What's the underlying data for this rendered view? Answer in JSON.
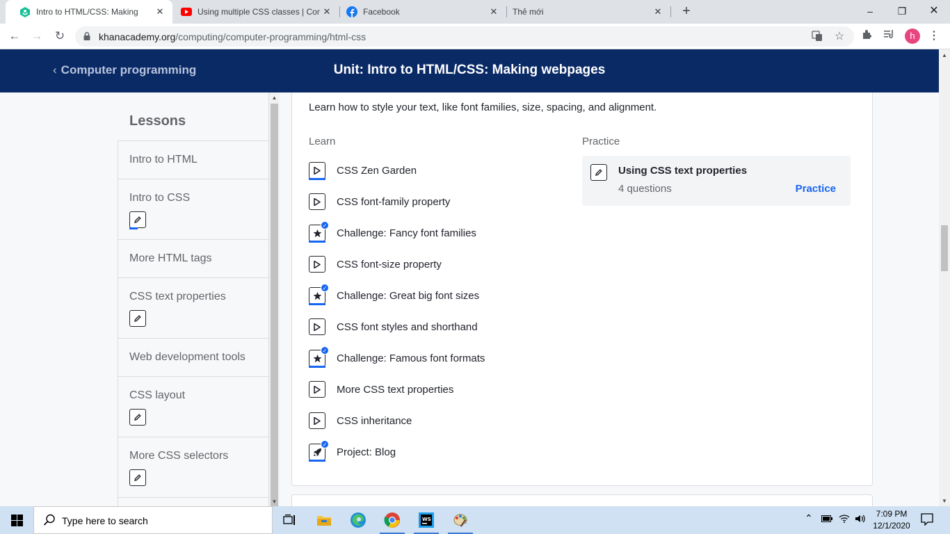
{
  "browser": {
    "tabs": [
      {
        "title": "Intro to HTML/CSS: Making webp",
        "active": true,
        "icon": "khan-academy-icon"
      },
      {
        "title": "Using multiple CSS classes | Com",
        "active": false,
        "icon": "youtube-icon"
      },
      {
        "title": "Facebook",
        "active": false,
        "icon": "facebook-icon"
      },
      {
        "title": "Thẻ mới",
        "active": false,
        "icon": ""
      }
    ],
    "url_host": "khanacademy.org",
    "url_path": "/computing/computer-programming/html-css",
    "profile_initial": "h"
  },
  "header": {
    "back_label": "Computer programming",
    "unit_title": "Unit: Intro to HTML/CSS: Making webpages"
  },
  "sidebar": {
    "heading": "Lessons",
    "items": [
      {
        "label": "Intro to HTML",
        "has_badge": false
      },
      {
        "label": "Intro to CSS",
        "has_badge": true
      },
      {
        "label": "More HTML tags",
        "has_badge": false
      },
      {
        "label": "CSS text properties",
        "has_badge": true
      },
      {
        "label": "Web development tools",
        "has_badge": false
      },
      {
        "label": "CSS layout",
        "has_badge": true
      },
      {
        "label": "More CSS selectors",
        "has_badge": true
      }
    ]
  },
  "lesson": {
    "description": "Learn how to style your text, like font families, size, spacing, and alignment.",
    "learn_heading": "Learn",
    "practice_heading": "Practice",
    "learn_items": [
      {
        "label": "CSS Zen Garden",
        "icon": "play-icon",
        "completed": false,
        "progress": "full"
      },
      {
        "label": "CSS font-family property",
        "icon": "play-icon",
        "completed": false,
        "progress": "none"
      },
      {
        "label": "Challenge: Fancy font families",
        "icon": "star-icon",
        "completed": true,
        "progress": "full"
      },
      {
        "label": "CSS font-size property",
        "icon": "play-icon",
        "completed": false,
        "progress": "none"
      },
      {
        "label": "Challenge: Great big font sizes",
        "icon": "star-icon",
        "completed": true,
        "progress": "full"
      },
      {
        "label": "CSS font styles and shorthand",
        "icon": "play-icon",
        "completed": false,
        "progress": "none"
      },
      {
        "label": "Challenge: Famous font formats",
        "icon": "star-icon",
        "completed": true,
        "progress": "full"
      },
      {
        "label": "More CSS text properties",
        "icon": "play-icon",
        "completed": false,
        "progress": "none"
      },
      {
        "label": "CSS inheritance",
        "icon": "play-icon",
        "completed": false,
        "progress": "none"
      },
      {
        "label": "Project: Blog",
        "icon": "rocket-icon",
        "completed": true,
        "progress": "full"
      }
    ],
    "practice": {
      "title": "Using CSS text properties",
      "subtitle": "4 questions",
      "action": "Practice"
    }
  },
  "taskbar": {
    "search_placeholder": "Type here to search",
    "time": "7:09 PM",
    "date": "12/1/2020"
  },
  "colors": {
    "header_bg": "#0a2a66",
    "accent": "#1865f2",
    "taskbar_bg": "#cfe1f3"
  }
}
